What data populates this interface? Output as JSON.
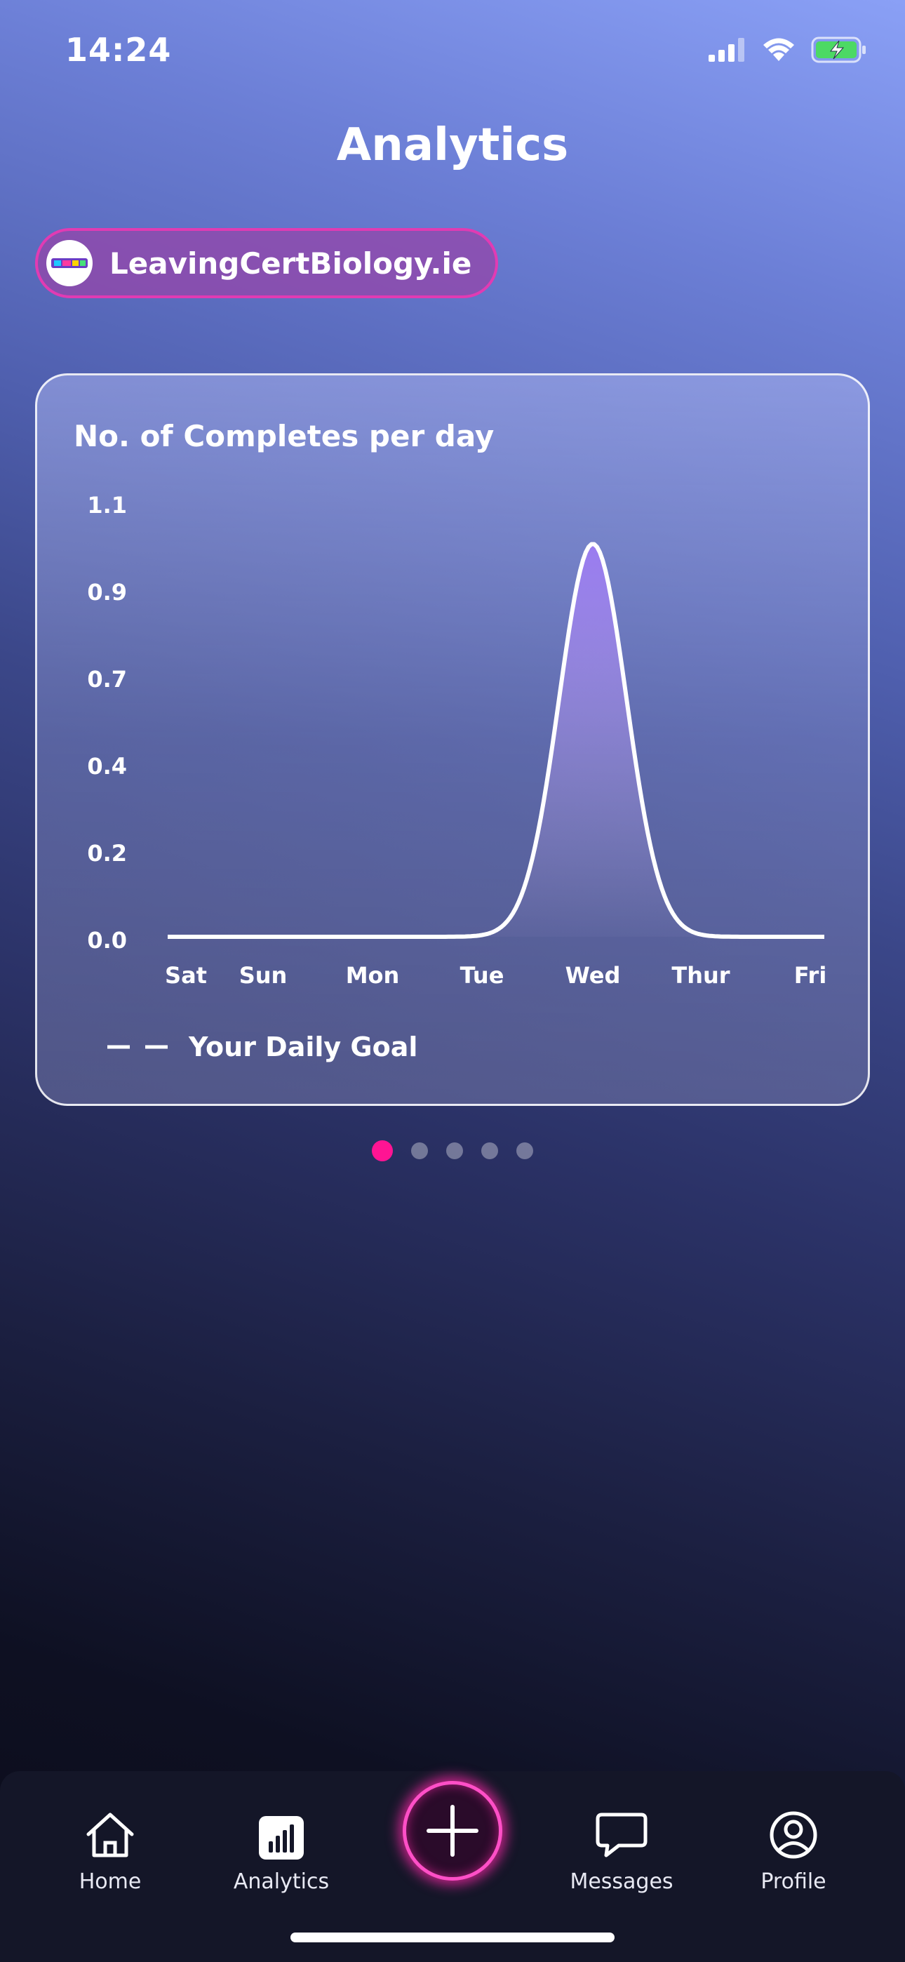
{
  "status_bar": {
    "time": "14:24",
    "icons": [
      "signal-icon",
      "wifi-icon",
      "battery-charging-icon"
    ]
  },
  "header": {
    "title": "Analytics"
  },
  "account_chip": {
    "label": "LeavingCertBiology.ie"
  },
  "chart_data": {
    "type": "area",
    "title": "No. of Completes per day",
    "categories": [
      "Sat",
      "Sun",
      "Mon",
      "Tue",
      "Wed",
      "Thur",
      "Fri"
    ],
    "values": [
      0,
      0,
      0,
      0,
      1,
      0,
      0
    ],
    "y_ticks": [
      "1.1",
      "0.9",
      "0.7",
      "0.4",
      "0.2",
      "0.0"
    ],
    "ylim": [
      0,
      1.1
    ],
    "legend": [
      {
        "label": "Your Daily Goal",
        "style": "dashed",
        "color": "#ffffff"
      }
    ],
    "fill_color": "#9a7cf0",
    "line_color": "#ffffff",
    "grid": false
  },
  "pagination": {
    "total": 5,
    "active_index": 0,
    "active_color": "#ff1493"
  },
  "tab_bar": {
    "tabs": [
      {
        "label": "Home",
        "icon": "home-icon"
      },
      {
        "label": "Analytics",
        "icon": "bar-chart-icon"
      },
      {
        "label": "",
        "icon": "plus-icon"
      },
      {
        "label": "Messages",
        "icon": "chat-bubble-icon"
      },
      {
        "label": "Profile",
        "icon": "user-circle-icon"
      }
    ],
    "accent_color": "#ff4fc7"
  }
}
